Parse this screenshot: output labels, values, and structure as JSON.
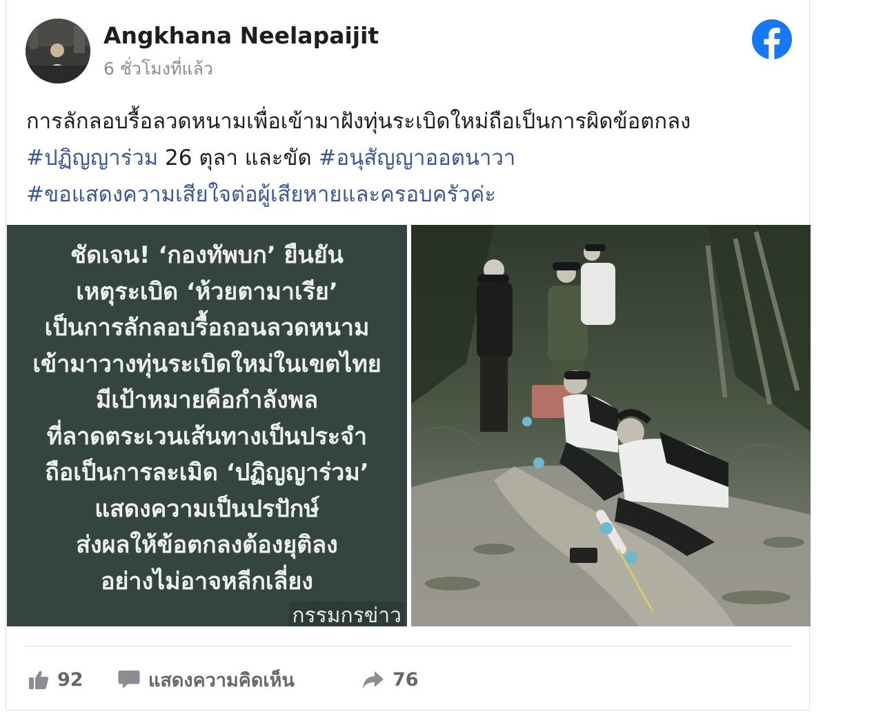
{
  "post": {
    "author": "Angkhana Neelapaijit",
    "time": "6 ชั่วโมงที่แล้ว",
    "text": {
      "line1": "การลักลอบรื้อลวดหนามเพื่อเข้ามาฝังทุ่นระเบิดใหม่ถือเป็นการผิดข้อตกลง",
      "hashtag1": "#ปฏิญญาร่วม",
      "line2_mid": " 26 ตุลา และขัด ",
      "hashtag2": "#อนุสัญญาออตนาวา",
      "hashtag3": "#ขอแสดงความเสียใจต่อผู้เสียหายและครอบครัวค่ะ"
    }
  },
  "image_text": {
    "lines": [
      "ชัดเจน! ‘กองทัพบก’ ยืนยัน",
      "เหตุระเบิด ‘ห้วยตามาเรีย’",
      "เป็นการลักลอบรื้อถอนลวดหนาม",
      "เข้ามาวางทุ่นระเบิดใหม่ในเขตไทย",
      "มีเป้าหมายคือกำลังพล",
      "ที่ลาดตระเวนเส้นทางเป็นประจำ",
      "ถือเป็นการละเมิด ‘ปฏิญญาร่วม’",
      "แสดงความเป็นปรปักษ์",
      "ส่งผลให้ข้อตกลงต้องยุติลง",
      "อย่างไม่อาจหลีกเลี่ยง"
    ],
    "credit": "กรรมกรข่าว"
  },
  "actions": {
    "likes": "92",
    "comment_label": "แสดงความคิดเห็น",
    "shares": "76"
  },
  "icons": {
    "platform": "facebook-icon",
    "like": "thumbs-up-icon",
    "comment": "comment-bubble-icon",
    "share": "share-arrow-icon"
  },
  "colors": {
    "facebook_blue": "#1877f2",
    "hashtag": "#385898",
    "panel_bg": "#344540",
    "muted": "#65676b"
  }
}
